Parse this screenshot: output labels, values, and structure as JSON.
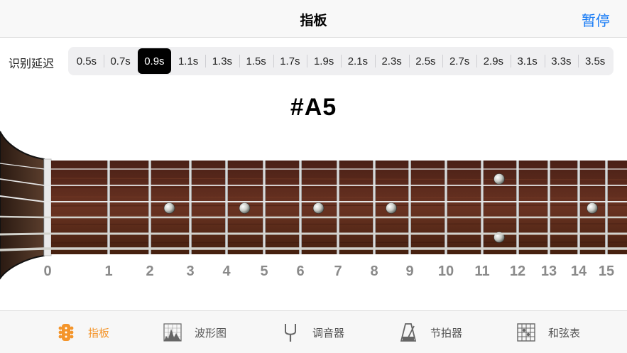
{
  "nav": {
    "title": "指板",
    "action_label": "暂停"
  },
  "delay": {
    "label": "识别延迟",
    "options": [
      "0.5s",
      "0.7s",
      "0.9s",
      "1.1s",
      "1.3s",
      "1.5s",
      "1.7s",
      "1.9s",
      "2.1s",
      "2.3s",
      "2.5s",
      "2.7s",
      "2.9s",
      "3.1s",
      "3.3s",
      "3.5s"
    ],
    "selected": "0.9s"
  },
  "note": "#A5",
  "fret_numbers": [
    "0",
    "1",
    "2",
    "3",
    "4",
    "5",
    "6",
    "7",
    "8",
    "9",
    "10",
    "11",
    "12",
    "13",
    "14",
    "15"
  ],
  "tabs": [
    {
      "label": "指板",
      "icon": "guitar-headstock-icon",
      "active": true
    },
    {
      "label": "波形图",
      "icon": "waveform-chart-icon",
      "active": false
    },
    {
      "label": "调音器",
      "icon": "tuning-fork-icon",
      "active": false
    },
    {
      "label": "节拍器",
      "icon": "metronome-icon",
      "active": false
    },
    {
      "label": "和弦表",
      "icon": "chord-grid-icon",
      "active": false
    }
  ],
  "colors": {
    "accent": "#1479f5",
    "active_tab": "#f4952b",
    "fretboard": "#5a2a1d"
  }
}
